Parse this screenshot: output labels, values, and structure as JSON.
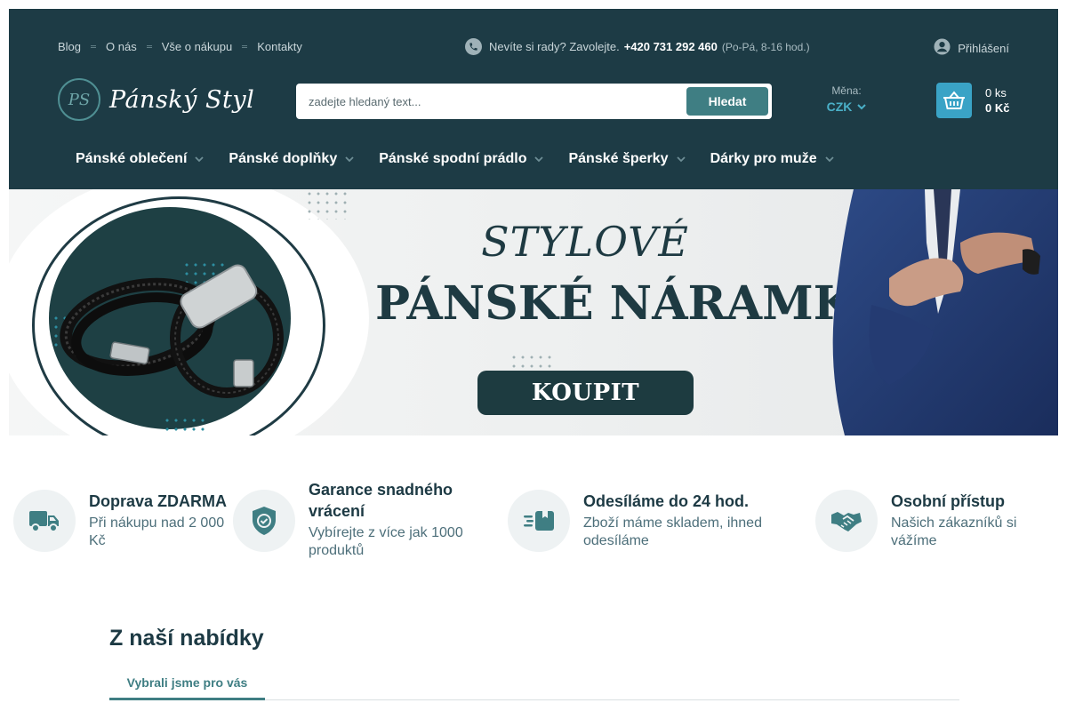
{
  "topbar": {
    "links": [
      "Blog",
      "O nás",
      "Vše o nákupu",
      "Kontakty"
    ],
    "phone_prompt": "Nevíte si rady? Zavolejte.",
    "phone_number": "+420 731 292 460",
    "phone_hours": "(Po-Pá, 8-16 hod.)",
    "login_label": "Přihlášení"
  },
  "logo": {
    "monogram": "PS",
    "name": "Pánský Styl"
  },
  "search": {
    "placeholder": "zadejte hledaný text...",
    "button_label": "Hledat"
  },
  "currency": {
    "label": "Měna:",
    "value": "CZK"
  },
  "cart": {
    "count": "0 ks",
    "total": "0 Kč"
  },
  "nav": {
    "items": [
      "Pánské oblečení",
      "Pánské doplňky",
      "Pánské spodní prádlo",
      "Pánské šperky",
      "Dárky pro muže"
    ]
  },
  "banner": {
    "title_line1": "STYLOVÉ",
    "title_line2": "PÁNSKÉ NÁRAMKY",
    "cta_label": "KOUPIT"
  },
  "features": [
    {
      "icon": "truck-icon",
      "title": "Doprava ZDARMA",
      "desc": "Při nákupu nad 2 000 Kč"
    },
    {
      "icon": "shield-check-icon",
      "title": "Garance snadného vrácení",
      "desc": "Vybírejte z více jak 1000 produktů"
    },
    {
      "icon": "fast-box-icon",
      "title": "Odesíláme do 24 hod.",
      "desc": "Zboží máme skladem, ihned odesíláme"
    },
    {
      "icon": "handshake-icon",
      "title": "Osobní přístup",
      "desc": "Našich zákazníků si vážíme"
    }
  ],
  "offer": {
    "title": "Z naší nabídky",
    "tabs": [
      "Vybrali jsme pro vás"
    ]
  },
  "colors": {
    "header_bg": "#1d3b45",
    "accent": "#3f7e83",
    "cart_blue": "#3aa3c6",
    "currency_blue": "#4ab0c8"
  }
}
